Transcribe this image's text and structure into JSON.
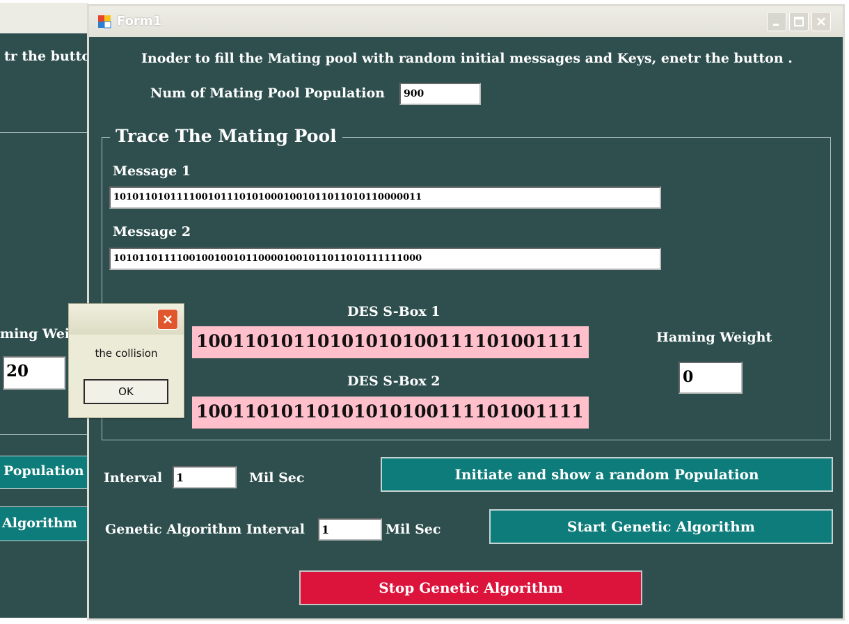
{
  "background_window": {
    "instruction_fragment": "tr the butto",
    "weight_label_fragment": "ming Wei",
    "weight_value": "20",
    "population_button_fragment": "Population",
    "algorithm_button_fragment": "Algorithm"
  },
  "window": {
    "title": "Form1"
  },
  "form": {
    "instruction": "Inoder to fill the Mating pool with random initial messages and Keys, enetr the button .",
    "population_label": "Num of Mating Pool Population",
    "population_value": "900",
    "group_title": "Trace The Mating Pool",
    "message1_label": "Message 1",
    "message1_value": "1010110101111001011101010001001011011010110000011",
    "message2_label": "Message 2",
    "message2_value": "1010110111100100100101100001001011011010111111000",
    "sbox1_label": "DES S-Box 1",
    "sbox1_value": "10011010110101010100111101001111",
    "sbox2_label": "DES S-Box 2",
    "sbox2_value": "10011010110101010100111101001111",
    "hamming_label": "Haming Weight",
    "hamming_value": "0",
    "interval_label": "Interval",
    "interval_value": "1",
    "interval_unit": "Mil Sec",
    "initiate_button": "Initiate and show a random  Population",
    "ga_interval_label": "Genetic Algorithm Interval",
    "ga_interval_value": "1",
    "ga_interval_unit": "Mil Sec",
    "start_button": "Start Genetic Algorithm",
    "stop_button": "Stop Genetic Algorithm"
  },
  "dialog": {
    "message": "the collision",
    "ok_button": "OK"
  },
  "colors": {
    "form_background": "#2f4f4f",
    "teal_button": "#0e7c7b",
    "stop_button": "#dc143c",
    "sbox_field": "#ffc0cb"
  },
  "icons": [
    "app-form-icon",
    "minimize-icon",
    "maximize-icon",
    "close-icon",
    "dialog-close-icon"
  ]
}
